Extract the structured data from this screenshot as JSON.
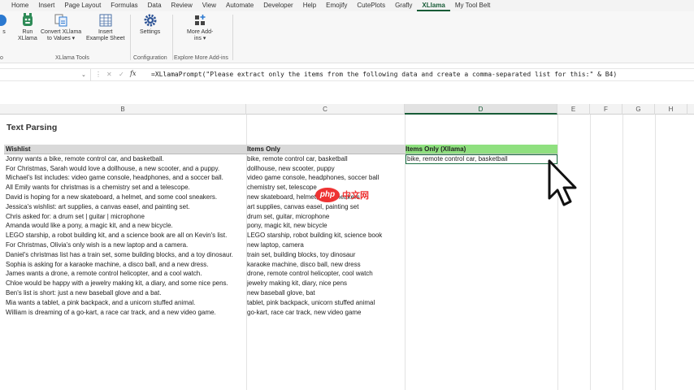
{
  "menu": {
    "tabs": [
      "Home",
      "Insert",
      "Page Layout",
      "Formulas",
      "Data",
      "Review",
      "View",
      "Automate",
      "Developer",
      "Help",
      "Emojify",
      "CutePlots",
      "Grafly",
      "XLlama",
      "My Tool Belt"
    ],
    "active_index": 13
  },
  "ribbon": {
    "run_label_1": "Run",
    "run_label_2": "XLlama",
    "convert_label_1": "Convert XLlama",
    "convert_label_2": "to Values",
    "insert_label_1": "Insert",
    "insert_label_2": "Example Sheet",
    "group_xllama_tools": "XLlama Tools",
    "settings_label": "Settings",
    "group_configuration": "Configuration",
    "more_addins_label_1": "More Add-",
    "more_addins_label_2": "ins",
    "group_explore": "Explore More Add-ins",
    "left_partial_1": "s",
    "left_partial_2": "o"
  },
  "formula_bar": {
    "formula": "=XLlamaPrompt(\"Please extract only the items from the following data and create a comma-separated list for this:\" & B4)"
  },
  "columns": [
    "B",
    "C",
    "D",
    "E",
    "F",
    "G",
    "H"
  ],
  "selected_column": "D",
  "sheet": {
    "title": "Text Parsing",
    "headers": {
      "wishlist": "Wishlist",
      "items_only": "Items Only",
      "items_only_xllama": "Items Only (Xllama)"
    },
    "selected_cell_value": "bike, remote control car, basketball",
    "rows": [
      {
        "wishlist": "Jonny wants a bike, remote control car, and basketball.",
        "items": "bike, remote control car, basketball"
      },
      {
        "wishlist": "For Christmas, Sarah would love a dollhouse, a new scooter, and a puppy.",
        "items": "dollhouse, new scooter, puppy"
      },
      {
        "wishlist": "Michael's list includes: video game console, headphones, and a soccer ball.",
        "items": "video game console, headphones, soccer ball"
      },
      {
        "wishlist": "All Emily wants for christmas is a chemistry set and a telescope.",
        "items": "chemistry set, telescope"
      },
      {
        "wishlist": "David is hoping for a new skateboard, a helmet, and some cool sneakers.",
        "items": "new skateboard, helmet, cool sneakers"
      },
      {
        "wishlist": "Jessica's wishlist: art supplies, a canvas easel, and painting set.",
        "items": "art supplies, canvas easel, painting set"
      },
      {
        "wishlist": "Chris asked for: a drum set | guitar | microphone",
        "items": "drum set, guitar, microphone"
      },
      {
        "wishlist": "Amanda would like a pony, a magic kit, and a new bicycle.",
        "items": "pony, magic kit, new bicycle"
      },
      {
        "wishlist": "LEGO starship, a robot building kit, and a science book are all on Kevin's list.",
        "items": "LEGO starship, robot building kit, science book"
      },
      {
        "wishlist": "For Christmas, Olivia's only wish is a new laptop and a camera.",
        "items": "new laptop, camera"
      },
      {
        "wishlist": "Daniel's christmas list has a train set, some building blocks, and a toy dinosaur.",
        "items": "train set, building blocks, toy dinosaur"
      },
      {
        "wishlist": "Sophia is asking for a karaoke machine, a disco ball, and a new dress.",
        "items": "karaoke machine, disco ball, new dress"
      },
      {
        "wishlist": "James wants a drone, a remote control helicopter, and a cool watch.",
        "items": "drone, remote control helicopter, cool watch"
      },
      {
        "wishlist": "Chloe would be happy with a jewelry making kit, a diary, and some nice pens.",
        "items": "jewelry making kit, diary, nice pens"
      },
      {
        "wishlist": "Ben's list is short: just a new baseball glove and a bat.",
        "items": "new baseball glove, bat"
      },
      {
        "wishlist": "Mia wants a tablet, a pink backpack, and a unicorn stuffed animal.",
        "items": "tablet, pink backpack, unicorn stuffed animal"
      },
      {
        "wishlist": "William is dreaming of a go-kart, a race car track, and a new video game.",
        "items": "go-kart, race car track, new video game"
      }
    ]
  },
  "watermark": {
    "logo": "php",
    "text": "中文网"
  },
  "colors": {
    "accent": "#185c37",
    "header_highlight": "#8fe07f",
    "header_gray": "#d9d9d9",
    "selection_border": "#1e7145"
  }
}
